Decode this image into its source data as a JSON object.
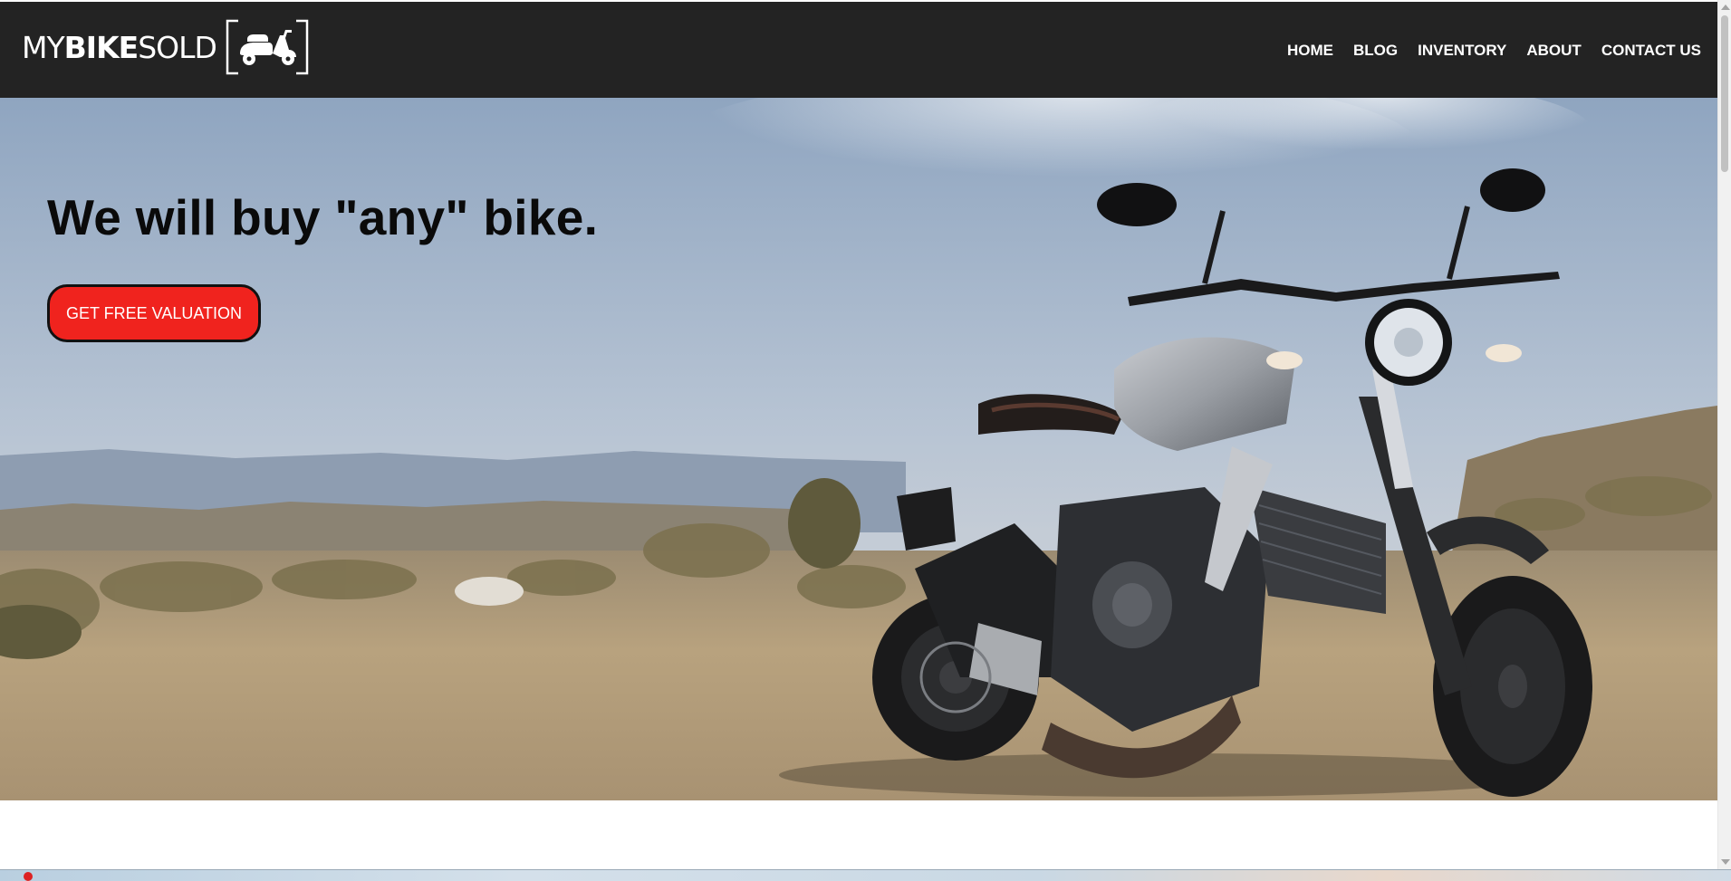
{
  "logo": {
    "text_light_1": "MY",
    "text_bold": "BIKE",
    "text_light_2": "SOLD",
    "icon": "scooter-icon"
  },
  "nav": {
    "items": [
      {
        "label": "HOME"
      },
      {
        "label": "BLOG"
      },
      {
        "label": "INVENTORY"
      },
      {
        "label": "ABOUT"
      },
      {
        "label": "CONTACT US"
      }
    ]
  },
  "hero": {
    "title": "We will buy \"any\" bike.",
    "cta_label": "GET FREE VALUATION",
    "image": "motorcycle-in-desert-photo"
  },
  "colors": {
    "navbar_bg": "#232323",
    "cta_bg": "#f0231e",
    "cta_border": "#111111",
    "title_color": "#0a0a0a"
  }
}
